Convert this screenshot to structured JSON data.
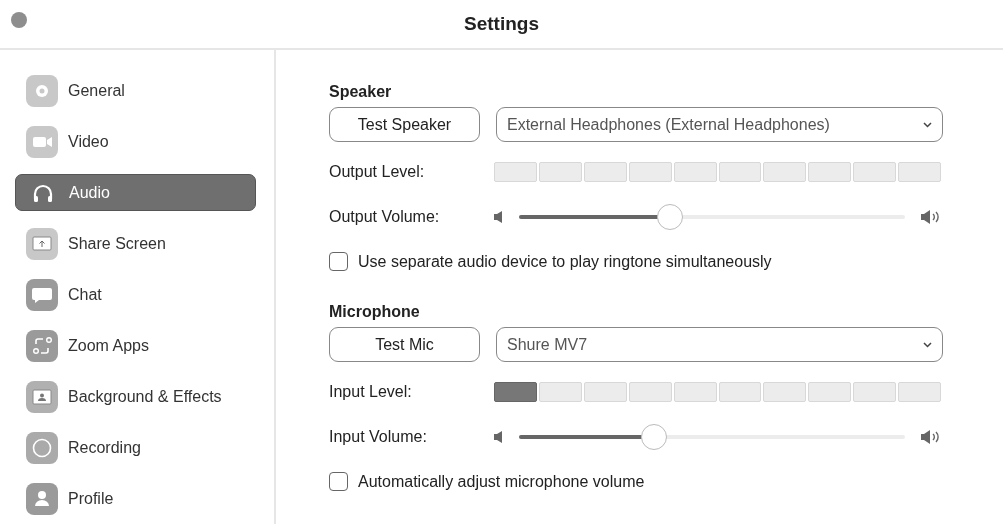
{
  "window": {
    "title": "Settings"
  },
  "sidebar": {
    "items": [
      {
        "label": "General",
        "selected": false
      },
      {
        "label": "Video",
        "selected": false
      },
      {
        "label": "Audio",
        "selected": true
      },
      {
        "label": "Share Screen",
        "selected": false
      },
      {
        "label": "Chat",
        "selected": false
      },
      {
        "label": "Zoom Apps",
        "selected": false
      },
      {
        "label": "Background & Effects",
        "selected": false
      },
      {
        "label": "Recording",
        "selected": false
      },
      {
        "label": "Profile",
        "selected": false
      }
    ]
  },
  "sections": [
    {
      "heading": "Speaker",
      "test_button": "Test Speaker",
      "device": "External Headphones (External Headphones)",
      "level_label": "Output Level:",
      "meter": {
        "segments": [
          {
            "lit": false
          },
          {
            "lit": false
          },
          {
            "lit": false
          },
          {
            "lit": false
          },
          {
            "lit": false
          },
          {
            "lit": false
          },
          {
            "lit": false
          },
          {
            "lit": false
          },
          {
            "lit": false
          },
          {
            "lit": false
          }
        ]
      },
      "volume_label": "Output Volume:",
      "volume": {
        "level": 0.39
      },
      "option": {
        "label": "Use separate audio device to play ringtone simultaneously",
        "checked": false
      }
    },
    {
      "heading": "Microphone",
      "test_button": "Test Mic",
      "device": "Shure MV7",
      "level_label": "Input Level:",
      "meter": {
        "segments": [
          {
            "lit": true
          },
          {
            "lit": false
          },
          {
            "lit": false
          },
          {
            "lit": false
          },
          {
            "lit": false
          },
          {
            "lit": false
          },
          {
            "lit": false
          },
          {
            "lit": false
          },
          {
            "lit": false
          },
          {
            "lit": false
          }
        ]
      },
      "volume_label": "Input Volume:",
      "volume": {
        "level": 0.35
      },
      "option": {
        "label": "Automatically adjust microphone volume",
        "checked": false
      }
    }
  ]
}
